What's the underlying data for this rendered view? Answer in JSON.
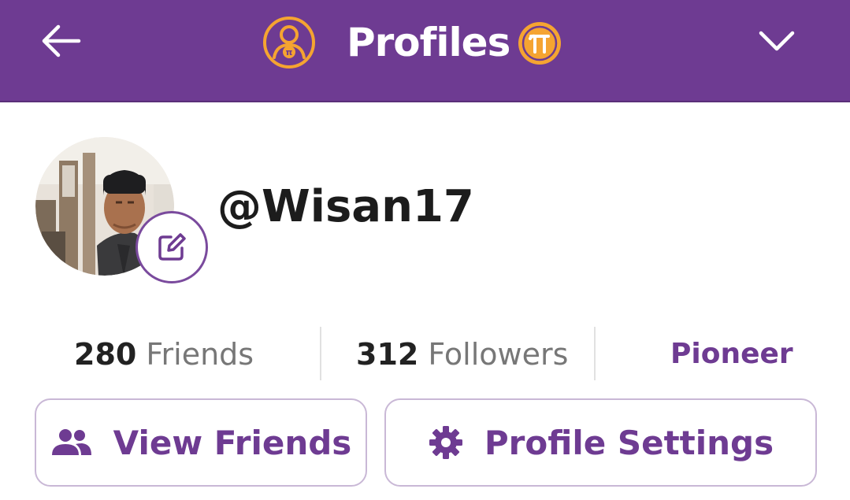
{
  "header": {
    "title": "Profiles",
    "back_icon": "arrow-left-icon",
    "profile_icon": "user-circle-icon",
    "pi_icon": "pi-coin-icon",
    "menu_icon": "chevron-down-icon"
  },
  "profile": {
    "username": "@Wisan17",
    "avatar": "user-photo",
    "edit_icon": "pencil-square-icon"
  },
  "stats": {
    "friends_count": "280",
    "friends_label": "Friends",
    "followers_count": "312",
    "followers_label": "Followers",
    "role": "Pioneer"
  },
  "buttons": {
    "view_friends": "View Friends",
    "view_friends_icon": "people-icon",
    "profile_settings": "Profile Settings",
    "profile_settings_icon": "gear-icon"
  },
  "colors": {
    "brand_purple": "#6e3b92",
    "accent_orange": "#f5a431",
    "text_dark": "#222222",
    "text_muted": "#777777"
  }
}
